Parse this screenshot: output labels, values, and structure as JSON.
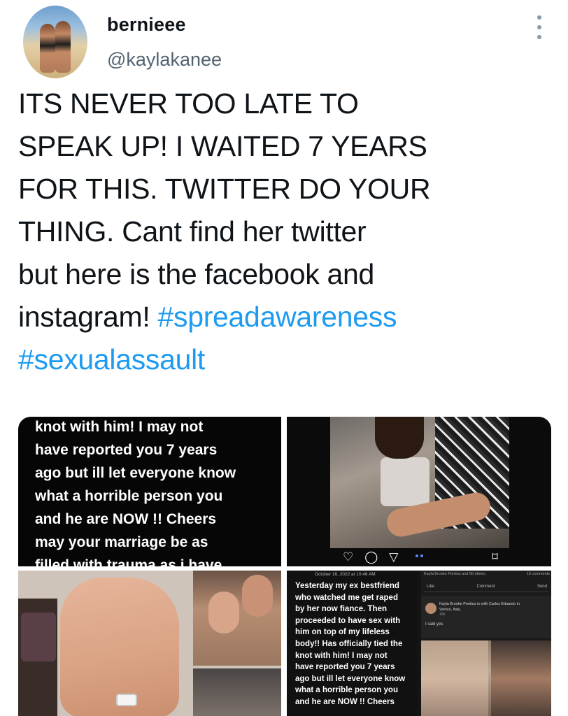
{
  "author": {
    "display_name": "bernieee",
    "handle": "@kaylakanee"
  },
  "tweet": {
    "lines": [
      "ITS NEVER TOO LATE TO",
      "SPEAK UP! I WAITED 7 YEARS",
      "FOR THIS. TWITTER DO YOUR",
      "THING. Cant find her twitter",
      "but here is the facebook and",
      "instagram! "
    ],
    "hashtags": [
      "#spreadawareness",
      "#sexualassault"
    ]
  },
  "media": {
    "story_lines": [
      "knot with him! I may not",
      "have reported you 7 years",
      "ago but ill let everyone know",
      "what a horrible person you",
      "and he are NOW !! Cheers",
      "may your marriage be as",
      "filled with trauma as i have"
    ],
    "fb_date": "October 16, 2022 at 10:46 AM",
    "fb_post_lines": [
      "Yesterday my ex bestfriend",
      "who watched me get raped",
      "by her now fiance. Then",
      "proceeded to have sex with",
      "him on top of my lifeless",
      "body!! Has officially tied the",
      "knot with him! I may not",
      "have reported you 7 years",
      "ago but ill let everyone know",
      "what a horrible person you",
      "and he are NOW !! Cheers"
    ],
    "fb_reactions": "Kayla Brooke Pontius and 50 others",
    "fb_comments_count": "15 comments",
    "fb_actions": [
      "Like",
      "Comment",
      "Send"
    ],
    "fb_shared_name_line1": "Kayla Brooke Pontius is with Carlos Eduardo in",
    "fb_shared_name_line2": "Venice, Italy.",
    "fb_shared_time": "10h",
    "fb_shared_caption": "I said yes"
  },
  "colors": {
    "hashtag": "#1d9bf0",
    "handle": "#536471",
    "text": "#0f1419"
  }
}
